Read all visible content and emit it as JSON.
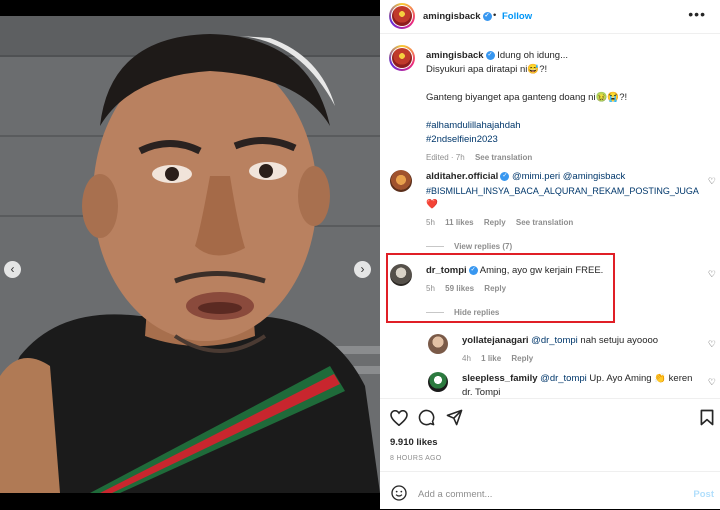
{
  "media": {
    "prev_icon": "‹",
    "next_icon": "›",
    "slides": 5,
    "current_slide": 1
  },
  "header": {
    "username": "amingisback",
    "verified_icon": "✓",
    "separator": "•",
    "follow_label": "Follow",
    "more_icon": "•••"
  },
  "caption": {
    "username": "amingisback",
    "line1": "Idung oh idung...",
    "line2": "Disyukuri apa diratapi ni😅?!",
    "line3": "Ganteng biyanget apa ganteng doang ni🤢😭?!",
    "hashtag1": "#alhamdulillahajahdah",
    "hashtag2": "#2ndselfiein2023",
    "edited": "Edited · 7h",
    "see_translation": "See translation"
  },
  "comments": [
    {
      "username": "alditaher.official",
      "mentions": "@mimi.peri @amingisback",
      "text": "#BISMILLAH_INSYA_BACA_ALQURAN_REKAM_POSTING_JUGA",
      "emoji": "❤️",
      "time": "5h",
      "likes": "11 likes",
      "reply": "Reply",
      "see_translation": "See translation",
      "view_replies": "View replies (7)"
    },
    {
      "username": "dr_tompi",
      "text": "Aming, ayo gw kerjain FREE.",
      "time": "5h",
      "likes": "59 likes",
      "reply": "Reply",
      "hide_replies": "Hide replies"
    }
  ],
  "replies": [
    {
      "username": "yollatejanagari",
      "mention": "@dr_tompi",
      "text": "nah setuju ayoooo",
      "time": "4h",
      "likes": "1 like",
      "reply": "Reply"
    },
    {
      "username": "sleepless_family",
      "mention": "@dr_tompi",
      "text": "Up. Ayo Aming 👏 keren",
      "text2": "dr. Tompi"
    }
  ],
  "actions": {
    "likes": "9.910 likes",
    "time_ago": "8 HOURS AGO",
    "comment_placeholder": "Add a comment...",
    "post_label": "Post"
  },
  "colors": {
    "link": "#0095f6",
    "hashtag": "#00376b",
    "verified": "#3897f0",
    "highlight": "#e01f26",
    "strap_green": "#1f6b3a",
    "strap_red": "#c8262e"
  }
}
